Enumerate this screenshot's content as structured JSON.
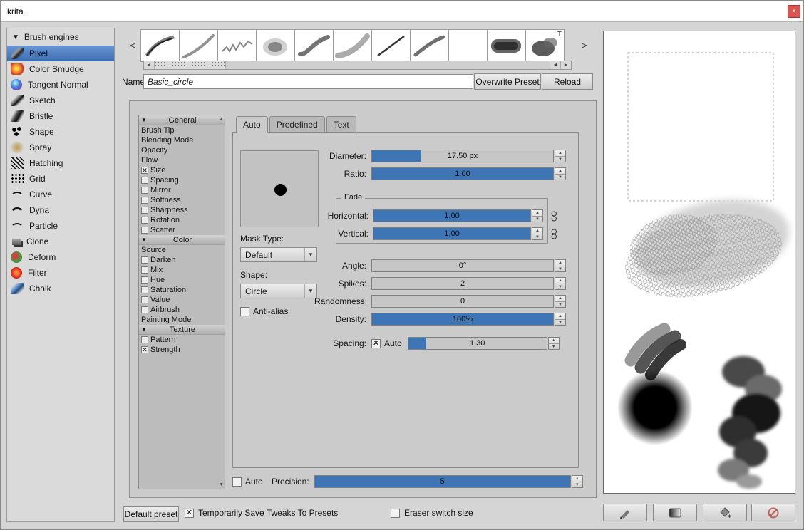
{
  "colors": {
    "accent": "#3e76b5",
    "selection_top": "#6a97d4",
    "selection_bottom": "#3c6cb0",
    "close": "#d9534f"
  },
  "icons": {
    "collapse": "▼",
    "up": "▲",
    "down": "▼",
    "left": "◄",
    "right": "►",
    "prev": "<",
    "next": ">",
    "close": "x"
  },
  "window": {
    "title": "krita"
  },
  "sidebar": {
    "header": "Brush engines",
    "items": [
      {
        "label": "Pixel",
        "selected": true
      },
      {
        "label": "Color Smudge",
        "selected": false
      },
      {
        "label": "Tangent Normal",
        "selected": false
      },
      {
        "label": "Sketch",
        "selected": false
      },
      {
        "label": "Bristle",
        "selected": false
      },
      {
        "label": "Shape",
        "selected": false
      },
      {
        "label": "Spray",
        "selected": false
      },
      {
        "label": "Hatching",
        "selected": false
      },
      {
        "label": "Grid",
        "selected": false
      },
      {
        "label": "Curve",
        "selected": false
      },
      {
        "label": "Dyna",
        "selected": false
      },
      {
        "label": "Particle",
        "selected": false
      },
      {
        "label": "Clone",
        "selected": false
      },
      {
        "label": "Deform",
        "selected": false
      },
      {
        "label": "Filter",
        "selected": false
      },
      {
        "label": "Chalk",
        "selected": false
      }
    ]
  },
  "presets": {
    "text_badge": "T"
  },
  "name_row": {
    "label": "Name:",
    "value": "Basic_circle",
    "overwrite": "Overwrite Preset",
    "reload": "Reload"
  },
  "options": {
    "rows": [
      {
        "label": "General",
        "type": "header"
      },
      {
        "label": "Brush Tip",
        "type": "plain"
      },
      {
        "label": "Blending Mode",
        "type": "plain"
      },
      {
        "label": "Opacity",
        "type": "plain"
      },
      {
        "label": "Flow",
        "type": "plain"
      },
      {
        "label": "Size",
        "type": "check",
        "checked": true
      },
      {
        "label": "Spacing",
        "type": "check",
        "checked": false
      },
      {
        "label": "Mirror",
        "type": "check",
        "checked": false
      },
      {
        "label": "Softness",
        "type": "check",
        "checked": false
      },
      {
        "label": "Sharpness",
        "type": "check",
        "checked": false
      },
      {
        "label": "Rotation",
        "type": "check",
        "checked": false
      },
      {
        "label": "Scatter",
        "type": "check",
        "checked": false
      },
      {
        "label": "Color",
        "type": "header"
      },
      {
        "label": "Source",
        "type": "plain"
      },
      {
        "label": "Darken",
        "type": "check",
        "checked": false
      },
      {
        "label": "Mix",
        "type": "check",
        "checked": false
      },
      {
        "label": "Hue",
        "type": "check",
        "checked": false
      },
      {
        "label": "Saturation",
        "type": "check",
        "checked": false
      },
      {
        "label": "Value",
        "type": "check",
        "checked": false
      },
      {
        "label": "Airbrush",
        "type": "check",
        "checked": false
      },
      {
        "label": "Painting Mode",
        "type": "plain"
      },
      {
        "label": "Texture",
        "type": "header"
      },
      {
        "label": "Pattern",
        "type": "check",
        "checked": false
      },
      {
        "label": "Strength",
        "type": "check",
        "checked": true
      }
    ]
  },
  "tabs": [
    {
      "label": "Auto",
      "selected": true
    },
    {
      "label": "Predefined",
      "selected": false
    },
    {
      "label": "Text",
      "selected": false
    }
  ],
  "auto_tab": {
    "mask_type_label": "Mask Type:",
    "mask_type_value": "Default",
    "shape_label": "Shape:",
    "shape_value": "Circle",
    "antialias": {
      "label": "Anti-alias",
      "checked": false
    },
    "sliders": {
      "diameter": {
        "label": "Diameter:",
        "value": "17.50 px",
        "fill": 0.27
      },
      "ratio": {
        "label": "Ratio:",
        "value": "1.00",
        "fill": 1
      },
      "angle": {
        "label": "Angle:",
        "value": "0°",
        "fill": 0
      },
      "spikes": {
        "label": "Spikes:",
        "value": "2",
        "fill": 0
      },
      "randomness": {
        "label": "Randomness:",
        "value": "0",
        "fill": 0
      },
      "density": {
        "label": "Density:",
        "value": "100%",
        "fill": 1
      }
    },
    "fade": {
      "title": "Fade",
      "horizontal": {
        "label": "Horizontal:",
        "value": "1.00",
        "fill": 1
      },
      "vertical": {
        "label": "Vertical:",
        "value": "1.00",
        "fill": 1
      }
    },
    "spacing": {
      "label": "Spacing:",
      "auto_label": "Auto",
      "auto_checked": true,
      "value": "1.30",
      "fill": 0.13
    },
    "precision": {
      "auto_label": "Auto",
      "auto_checked": false,
      "label": "Precision:",
      "value": "5",
      "fill": 1
    }
  },
  "footer": {
    "default_preset": "Default preset",
    "tweaks": {
      "label": "Temporarily Save Tweaks To Presets",
      "checked": true
    },
    "eraser": {
      "label": "Eraser switch size",
      "checked": false
    }
  }
}
